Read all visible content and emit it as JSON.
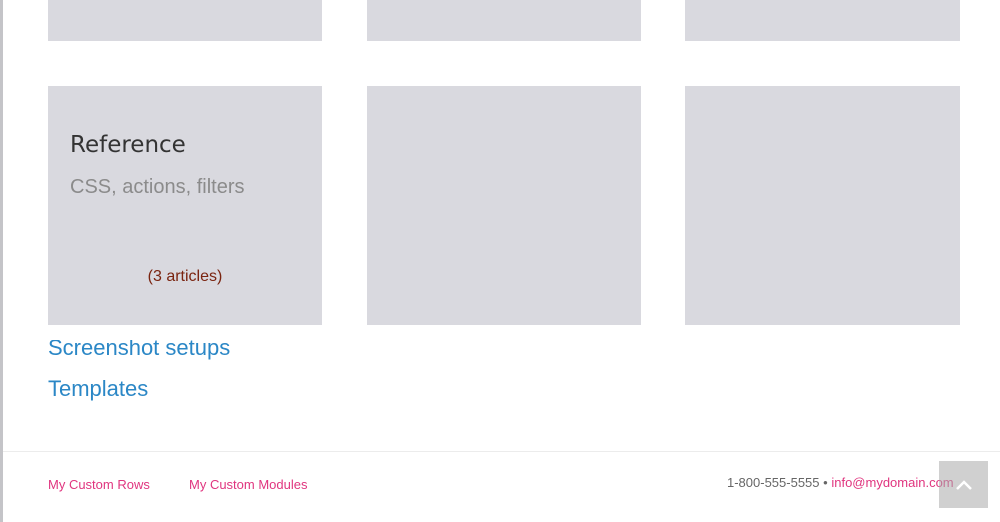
{
  "tiles": {
    "reference": {
      "title": "Reference",
      "subtitle": "CSS, actions, filters",
      "count": "(3 articles)"
    }
  },
  "categories": {
    "screenshot_setups": "Screenshot setups",
    "templates": "Templates"
  },
  "footer": {
    "links": [
      "My Custom Rows",
      "My Custom Modules"
    ],
    "phone": "1-800-555-5555",
    "separator": "•",
    "email": "info@mydomain.com"
  },
  "icons": {
    "back_to_top": "chevron-up-icon"
  },
  "colors": {
    "tile_bg": "#d9d9df",
    "link_blue": "#2b87c6",
    "footer_pink": "#e0357f",
    "article_count": "#7a2410"
  }
}
